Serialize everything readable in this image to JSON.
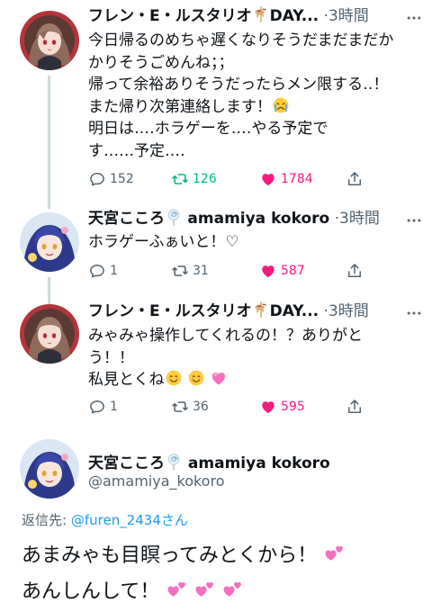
{
  "tweets": [
    {
      "author": "フレン・E・ルスタリオ",
      "author_suffix": "DAY...",
      "time": "3時間",
      "lines": [
        "今日帰るのめちゃ遅くなりそうだまだまだか",
        "かりそうごめんね；；",
        "帰って余裕ありそうだったらメン限する‥！",
        "また帰り次第連絡します！",
        "明日は‥‥ホラゲーを‥‥やる予定で",
        "す‥‥‥予定‥‥"
      ],
      "replies": "152",
      "retweets": "126",
      "likes": "1784",
      "retweeted": true
    },
    {
      "author": "天宮こころ",
      "handle_inline": "amamiya kokoro",
      "time": "3時間",
      "lines": [
        "ホラゲーふぁいと！♡"
      ],
      "replies": "1",
      "retweets": "31",
      "likes": "587"
    },
    {
      "author": "フレン・E・ルスタリオ",
      "author_suffix": "DAY...",
      "time": "3時間",
      "lines": [
        "みゃみゃ操作してくれるの！？ありがと",
        "う！！",
        "私見とくね"
      ],
      "replies": "1",
      "retweets": "36",
      "likes": "595"
    }
  ],
  "main_tweet": {
    "author": "天宮こころ",
    "display_suffix": "amamiya kokoro",
    "handle": "@amamiya_kokoro",
    "reply_to_label": "返信先:",
    "reply_to_link": "@furen_2434さん",
    "lines": [
      "あまみゃも目瞑ってみとくから！",
      "あんしんして！"
    ]
  },
  "colors": {
    "text": "#0f1419",
    "muted": "#536471",
    "link": "#1d9bf0",
    "retweet_active": "#00ba7c",
    "like_active": "#f91880",
    "divider": "#cfd9de"
  },
  "icons": [
    "more-icon",
    "reply-icon",
    "retweet-icon",
    "like-icon",
    "share-icon",
    "carousel-horse-emoji",
    "lollipop-emoji",
    "crying-face-emoji",
    "smiling-face-emoji",
    "growing-heart-emoji",
    "two-hearts-emoji"
  ]
}
